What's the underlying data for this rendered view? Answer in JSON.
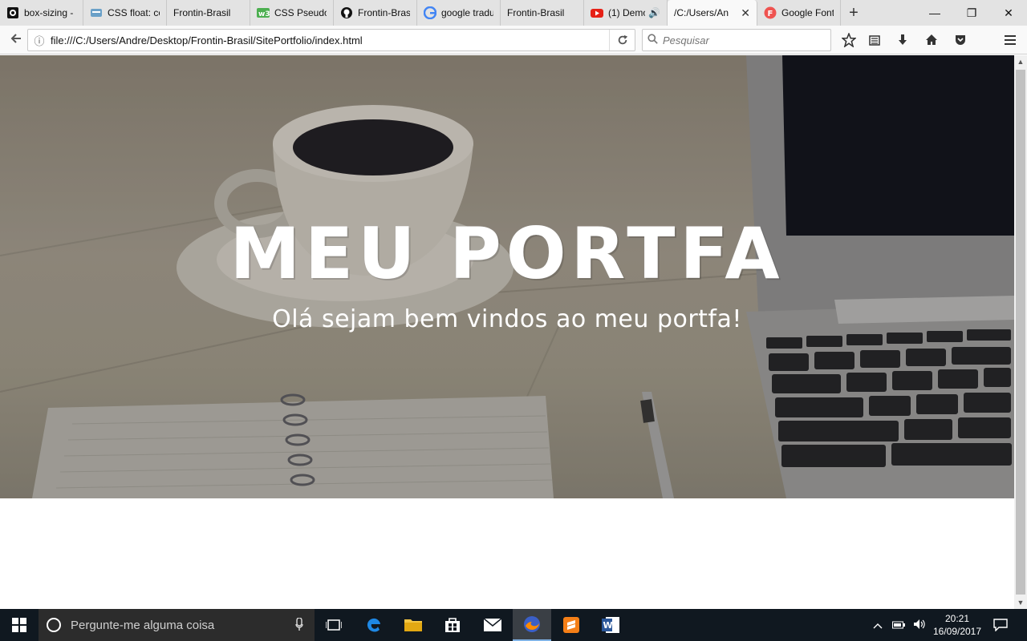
{
  "browser": {
    "tabs": [
      {
        "label": "box-sizing -",
        "icon": "github-icon"
      },
      {
        "label": "CSS float: co",
        "icon": "site-icon"
      },
      {
        "label": "Frontin-Brasil",
        "icon": "none"
      },
      {
        "label": "CSS Pseudo-",
        "icon": "w3-icon"
      },
      {
        "label": "Frontin-Bras",
        "icon": "github-icon"
      },
      {
        "label": "google tradu",
        "icon": "google-icon"
      },
      {
        "label": "Frontin-Brasil",
        "icon": "none"
      },
      {
        "label": "(1) Demo",
        "icon": "youtube-icon"
      },
      {
        "label": "/C:/Users/An",
        "icon": "none"
      },
      {
        "label": "Google Font",
        "icon": "google-fonts-icon"
      }
    ],
    "new_tab": "+",
    "window": {
      "minimize": "—",
      "restore": "❐",
      "close": "✕"
    },
    "url": "file:///C:/Users/Andre/Desktop/Frontin-Brasil/SitePortfolio/index.html",
    "search_placeholder": "Pesquisar",
    "colors": {
      "youtube": "#e62117",
      "google_fonts": "#ef5350"
    }
  },
  "page": {
    "hero_title": "MEU PORTFA",
    "hero_subtitle": "Olá sejam bem vindos ao meu portfa!"
  },
  "taskbar": {
    "search_placeholder": "Pergunte-me alguma coisa",
    "time": "20:21",
    "date": "16/09/2017"
  }
}
